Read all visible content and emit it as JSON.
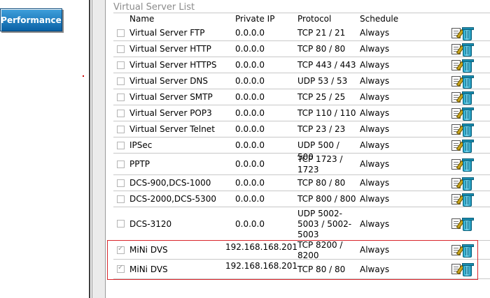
{
  "sidebar": {
    "performance_label": "Performance"
  },
  "section": {
    "title": "Virtual Server List"
  },
  "table": {
    "headers": {
      "name": "Name",
      "ip": "Private IP",
      "protocol": "Protocol",
      "schedule": "Schedule"
    },
    "rows": [
      {
        "checked": false,
        "name": "Virtual Server FTP",
        "ip": "0.0.0.0",
        "protocol": "TCP 21 / 21",
        "schedule": "Always"
      },
      {
        "checked": false,
        "name": "Virtual Server HTTP",
        "ip": "0.0.0.0",
        "protocol": "TCP 80 / 80",
        "schedule": "Always"
      },
      {
        "checked": false,
        "name": "Virtual Server HTTPS",
        "ip": "0.0.0.0",
        "protocol": "TCP 443 / 443",
        "schedule": "Always"
      },
      {
        "checked": false,
        "name": "Virtual Server DNS",
        "ip": "0.0.0.0",
        "protocol": "UDP 53 / 53",
        "schedule": "Always"
      },
      {
        "checked": false,
        "name": "Virtual Server SMTP",
        "ip": "0.0.0.0",
        "protocol": "TCP 25 / 25",
        "schedule": "Always"
      },
      {
        "checked": false,
        "name": "Virtual Server POP3",
        "ip": "0.0.0.0",
        "protocol": "TCP 110 / 110",
        "schedule": "Always"
      },
      {
        "checked": false,
        "name": "Virtual Server Telnet",
        "ip": "0.0.0.0",
        "protocol": "TCP 23 / 23",
        "schedule": "Always"
      },
      {
        "checked": false,
        "name": "IPSec",
        "ip": "0.0.0.0",
        "protocol": "UDP 500 / 500",
        "schedule": "Always"
      },
      {
        "checked": false,
        "name": "PPTP",
        "ip": "0.0.0.0",
        "protocol": "TCP 1723 / 1723",
        "schedule": "Always"
      },
      {
        "checked": false,
        "name": "DCS-900,DCS-1000",
        "ip": "0.0.0.0",
        "protocol": "TCP 80 / 80",
        "schedule": "Always"
      },
      {
        "checked": false,
        "name": "DCS-2000,DCS-5300",
        "ip": "0.0.0.0",
        "protocol": "TCP 800 / 800",
        "schedule": "Always"
      },
      {
        "checked": false,
        "name": "DCS-3120",
        "ip": "0.0.0.0",
        "protocol": "UDP 5002-5003 / 5002-5003",
        "schedule": "Always"
      },
      {
        "checked": true,
        "name": "MiNi DVS",
        "ip": "192.168.168.201",
        "protocol": "TCP 8200 / 8200",
        "schedule": "Always"
      },
      {
        "checked": true,
        "name": "MiNi DVS",
        "ip": "192.168.168.201",
        "protocol": "TCP 80 / 80",
        "schedule": "Always"
      }
    ]
  },
  "icons": {
    "edit": "edit-icon",
    "delete": "trash-icon"
  },
  "colors": {
    "highlight_border": "#d9262c",
    "button_blue": "#0a62a6",
    "section_title": "#8c8c8c"
  }
}
